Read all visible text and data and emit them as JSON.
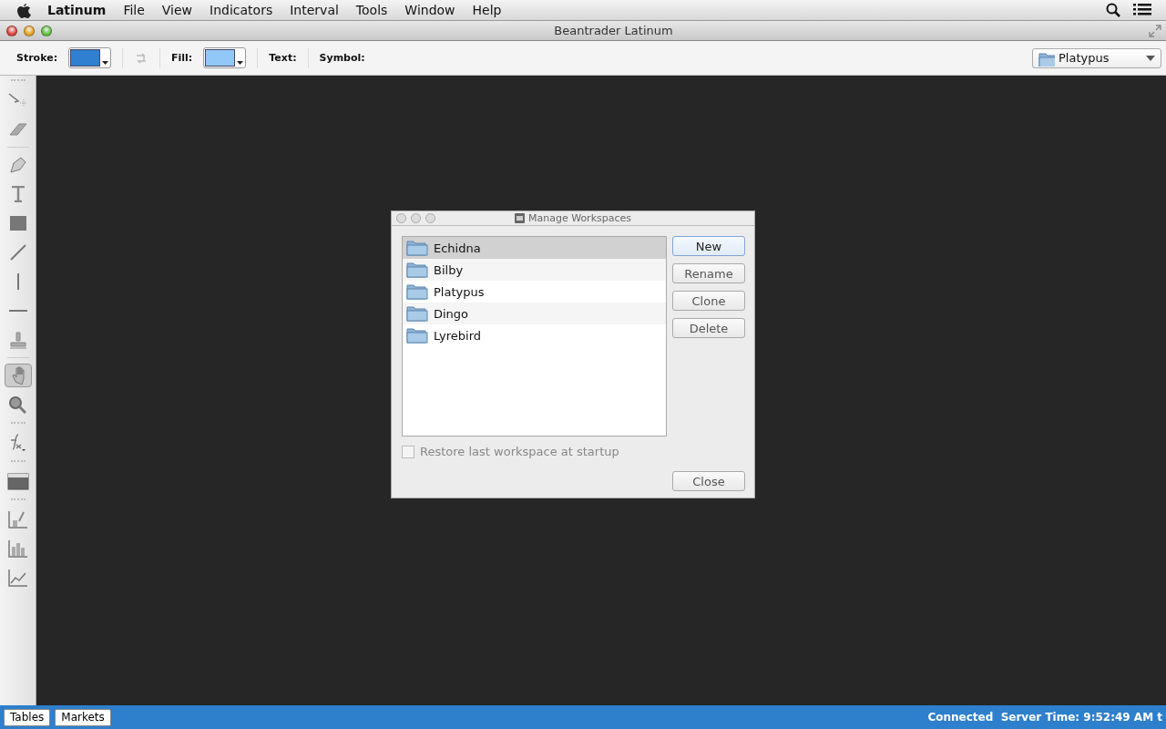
{
  "menu_bar": {
    "app": "Latinum",
    "items": [
      "File",
      "View",
      "Indicators",
      "Interval",
      "Tools",
      "Window",
      "Help"
    ]
  },
  "window": {
    "title": "Beantrader Latinum"
  },
  "toolbar": {
    "stroke_label": "Stroke:",
    "stroke": {
      "color": "#2f80d0"
    },
    "fill_label": "Fill:",
    "fill": {
      "color": "#92c8f8"
    },
    "text_label": "Text:",
    "symbol_label": "Symbol:",
    "workspace": "Platypus"
  },
  "tools": [
    {
      "kind": "grip"
    },
    {
      "kind": "select",
      "selected": false
    },
    {
      "kind": "eraser",
      "selected": false
    },
    {
      "kind": "rule"
    },
    {
      "kind": "pen",
      "selected": false
    },
    {
      "kind": "text",
      "selected": false
    },
    {
      "kind": "rect",
      "selected": false
    },
    {
      "kind": "diagonal",
      "selected": false
    },
    {
      "kind": "vertical",
      "selected": false
    },
    {
      "kind": "horizontal",
      "selected": false
    },
    {
      "kind": "stamp",
      "selected": false
    },
    {
      "kind": "rule"
    },
    {
      "kind": "hand",
      "selected": true
    },
    {
      "kind": "zoom",
      "selected": false
    },
    {
      "kind": "grip"
    },
    {
      "kind": "formula",
      "selected": false
    },
    {
      "kind": "grip"
    },
    {
      "kind": "panel",
      "selected": false
    },
    {
      "kind": "grip"
    },
    {
      "kind": "paint-chart",
      "selected": false
    },
    {
      "kind": "bar-chart",
      "selected": false
    },
    {
      "kind": "line-chart",
      "selected": false
    }
  ],
  "dialog": {
    "title": "Manage Workspaces",
    "workspaces": [
      {
        "name": "Echidna",
        "selected": true
      },
      {
        "name": "Bilby",
        "selected": false
      },
      {
        "name": "Platypus",
        "selected": false
      },
      {
        "name": "Dingo",
        "selected": false
      },
      {
        "name": "Lyrebird",
        "selected": false
      }
    ],
    "buttons": [
      {
        "label": "New",
        "default": true
      },
      {
        "label": "Rename",
        "default": false
      },
      {
        "label": "Clone",
        "default": false
      },
      {
        "label": "Delete",
        "default": false
      }
    ],
    "restore_checkbox": {
      "label": "Restore last workspace at startup",
      "checked": false,
      "disabled": true
    },
    "close_button": "Close"
  },
  "status_bar": {
    "tabs": [
      "Tables",
      "Markets"
    ],
    "status": "Connected  Server Time: 9:52:49 AM t"
  }
}
